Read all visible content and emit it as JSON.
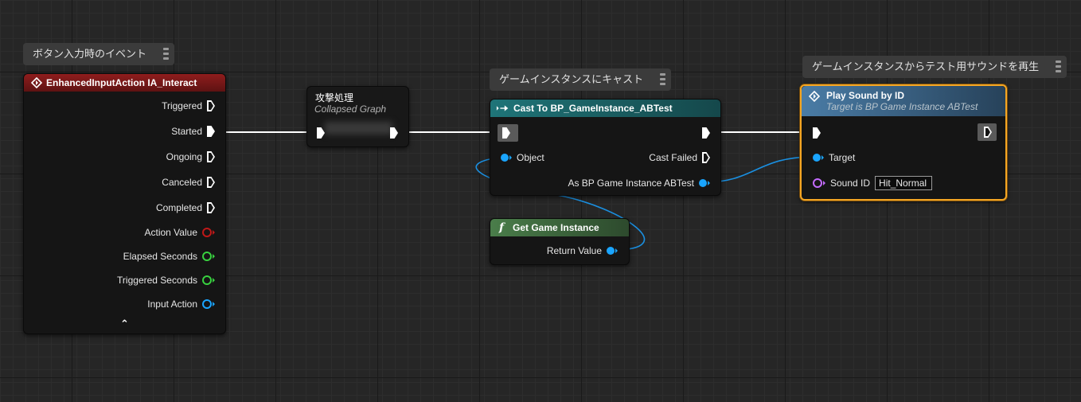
{
  "comments": {
    "event": "ボタン入力時のイベント",
    "cast": "ゲームインスタンスにキャスト",
    "play": "ゲームインスタンスからテスト用サウンドを再生"
  },
  "event_node": {
    "title": "EnhancedInputAction IA_Interact",
    "header_color": "#7a1717",
    "pins": {
      "triggered": "Triggered",
      "started": "Started",
      "ongoing": "Ongoing",
      "canceled": "Canceled",
      "completed": "Completed",
      "action_value": "Action Value",
      "elapsed_seconds": "Elapsed Seconds",
      "triggered_seconds": "Triggered Seconds",
      "input_action": "Input Action"
    },
    "collapse_glyph": "⌃"
  },
  "collapsed_node": {
    "title": "攻撃処理",
    "subtitle": "Collapsed Graph"
  },
  "cast_node": {
    "title": "Cast To BP_GameInstance_ABTest",
    "header_color": "#1d6a6e",
    "pins": {
      "object": "Object",
      "cast_failed": "Cast Failed",
      "as_instance": "As BP Game Instance ABTest"
    }
  },
  "get_instance_node": {
    "title": "Get Game Instance",
    "glyph": "f",
    "header_color": "#3f6a3f",
    "pins": {
      "return_value": "Return Value"
    }
  },
  "play_node": {
    "title": "Play Sound by ID",
    "subtitle": "Target is BP Game Instance ABTest",
    "header_color": "#3e6a8f",
    "pins": {
      "target": "Target",
      "sound_id": "Sound ID",
      "sound_id_value": "Hit_Normal"
    }
  },
  "colors": {
    "exec": "#ffffff",
    "object": "#1aa5ff",
    "action_value": "#c01818",
    "float": "#38d13f",
    "name": "#c46bff",
    "selection": "#f5a623"
  }
}
